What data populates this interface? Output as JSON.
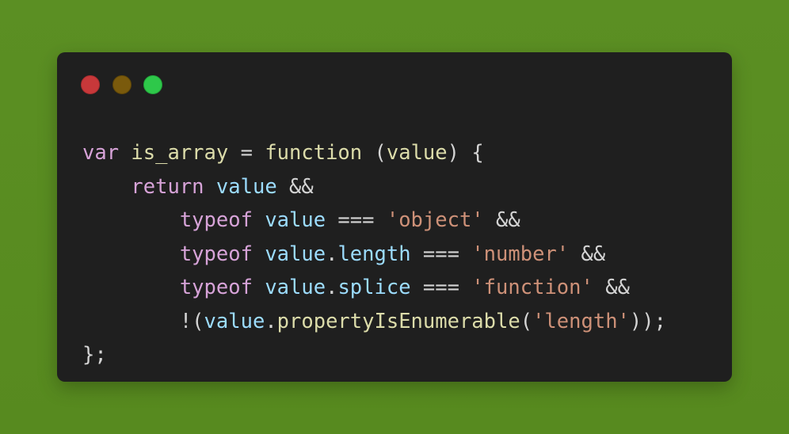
{
  "window": {
    "controls": {
      "close": "close-dot",
      "minimize": "minimize-dot",
      "maximize": "maximize-dot"
    }
  },
  "code": {
    "line1": {
      "kw_var": "var",
      "name": "is_array",
      "eq": " = ",
      "kw_function": "function",
      "open": " (",
      "param": "value",
      "close": ") {"
    },
    "line2": {
      "indent": "    ",
      "kw_return": "return",
      "sp": " ",
      "val": "value",
      "op": " &&"
    },
    "line3": {
      "indent": "        ",
      "kw_typeof": "typeof",
      "sp": " ",
      "val": "value",
      "op": " === ",
      "str": "'object'",
      "and": " &&"
    },
    "line4": {
      "indent": "        ",
      "kw_typeof": "typeof",
      "sp": " ",
      "val": "value",
      "dot": ".",
      "prop": "length",
      "op": " === ",
      "str": "'number'",
      "and": " &&"
    },
    "line5": {
      "indent": "        ",
      "kw_typeof": "typeof",
      "sp": " ",
      "val": "value",
      "dot": ".",
      "prop": "splice",
      "op": " === ",
      "str": "'function'",
      "and": " &&"
    },
    "line6": {
      "indent": "        ",
      "open": "!(",
      "val": "value",
      "dot": ".",
      "prop": "propertyIsEnumerable",
      "paren": "(",
      "str": "'length'",
      "close": "));"
    },
    "line7": {
      "close": "};"
    }
  },
  "colors": {
    "background": "#5a8c22",
    "window": "#1f1f1f",
    "keyword": "#d7a3d8",
    "function": "#dcdcaa",
    "variable": "#9cdcfe",
    "string": "#ce9178",
    "text": "#d4d4d4"
  }
}
